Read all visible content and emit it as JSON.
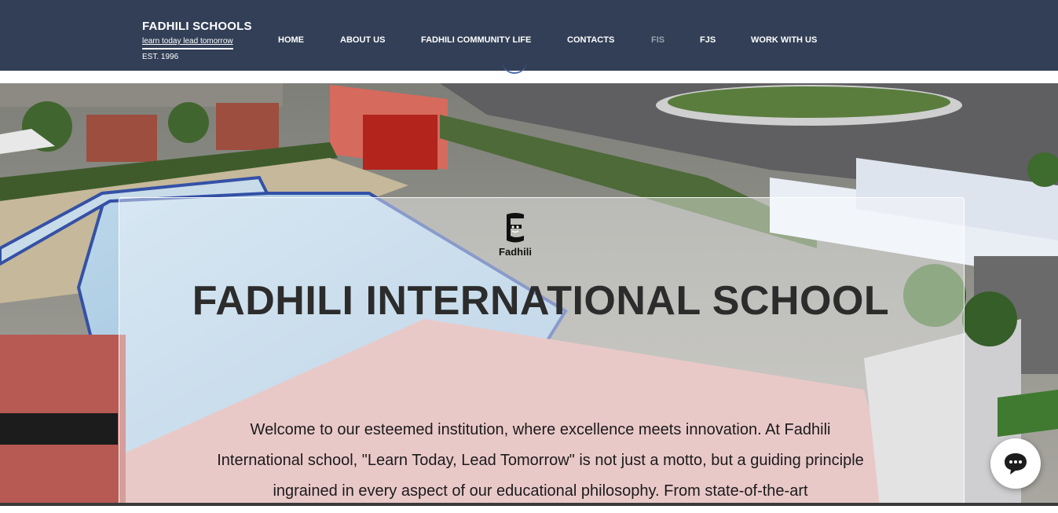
{
  "header": {
    "brand_name": "FADHILI SCHOOLS",
    "tagline": "learn today lead tomorrow",
    "established": "EST. 1996",
    "background_color": "#323f56"
  },
  "nav": {
    "items": [
      {
        "label": "HOME"
      },
      {
        "label": "ABOUT US"
      },
      {
        "label": "FADHILI COMMUNITY LIFE"
      },
      {
        "label": "CONTACTS"
      },
      {
        "label": "FIS"
      },
      {
        "label": "FJS"
      },
      {
        "label": "WORK WITH US"
      }
    ],
    "active": "FIS"
  },
  "hero": {
    "logo_label": "Fadhili",
    "title": "FADHILI INTERNATIONAL SCHOOL",
    "paragraph": "Welcome to our esteemed institution, where excellence meets innovation. At Fadhili International school, \"Learn Today, Lead Tomorrow\" is not just a motto, but a guiding principle ingrained in every aspect of our educational philosophy. From state-of-the-art"
  },
  "chat": {
    "icon": "chat-bubble-icon"
  }
}
